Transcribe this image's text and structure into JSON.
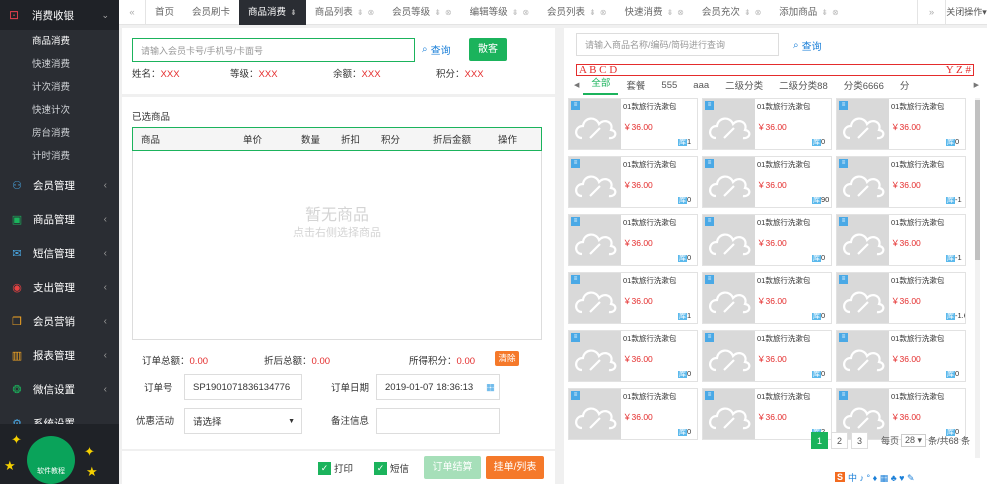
{
  "sidebar": {
    "section_title": "消费收银",
    "sub_items": [
      "商品消费",
      "快速消费",
      "计次消费",
      "快速计次",
      "房台消费",
      "计时消费"
    ],
    "items": [
      {
        "label": "会员管理",
        "icon": "users-icon"
      },
      {
        "label": "商品管理",
        "icon": "box-icon"
      },
      {
        "label": "短信管理",
        "icon": "sms-icon"
      },
      {
        "label": "支出管理",
        "icon": "money-icon"
      },
      {
        "label": "会员营销",
        "icon": "gift-icon"
      },
      {
        "label": "报表管理",
        "icon": "chart-icon"
      },
      {
        "label": "微信设置",
        "icon": "wechat-icon"
      },
      {
        "label": "系统设置",
        "icon": "gear-icon"
      }
    ],
    "brand_label": "软件教程"
  },
  "tabs": [
    {
      "label": "首页",
      "closable": false
    },
    {
      "label": "会员刷卡",
      "closable": false
    },
    {
      "label": "商品消费",
      "closable": false,
      "active": true,
      "mark": "⇟"
    },
    {
      "label": "商品列表",
      "closable": true
    },
    {
      "label": "会员等级",
      "closable": true
    },
    {
      "label": "编辑等级",
      "closable": true
    },
    {
      "label": "会员列表",
      "closable": true
    },
    {
      "label": "快速消费",
      "closable": true
    },
    {
      "label": "会员充次",
      "closable": true
    },
    {
      "label": "添加商品",
      "closable": true
    }
  ],
  "close_ops": "关闭操作",
  "member": {
    "search_placeholder": "请输入会员卡号/手机号/卡面号",
    "query_label": "查询",
    "walkin_label": "散客",
    "name_label": "姓名：",
    "name_value": "XXX",
    "level_label": "等级：",
    "level_value": "XXX",
    "balance_label": "余额：",
    "balance_value": "XXX",
    "points_label": "积分：",
    "points_value": "XXX"
  },
  "cart": {
    "title": "已选商品",
    "columns": [
      "商品",
      "单价",
      "数量",
      "折扣",
      "积分",
      "折后金额",
      "操作"
    ],
    "empty_title": "暂无商品",
    "empty_hint": "点击右侧选择商品"
  },
  "summary": {
    "total_label": "订单总额：",
    "total_value": "0.00",
    "discount_label": "折后总额：",
    "discount_value": "0.00",
    "points_label": "所得积分：",
    "points_value": "0.00",
    "clear_label": "清除"
  },
  "order": {
    "no_label": "订单号",
    "no_value": "SP1901071836134776",
    "date_label": "订单日期",
    "date_value": "2019-01-07 18:36:13",
    "promo_label": "优惠活动",
    "promo_value": "请选择",
    "remark_label": "备注信息",
    "remark_value": ""
  },
  "actions": {
    "print": "打印",
    "sms": "短信",
    "checkout": "订单结算",
    "hold": "挂单/列表"
  },
  "products": {
    "search_placeholder": "请输入商品名称/编码/简码进行查询",
    "query_label": "查询",
    "letters_left": "A B C D",
    "letters_right": "Y Z #",
    "categories": [
      "全部",
      "套餐",
      "555",
      "aaa",
      "二级分类",
      "二级分类88",
      "分类6666",
      "分"
    ],
    "items": [
      {
        "name": "01款旅行洗漱包",
        "price": "36.00",
        "stock": "1"
      },
      {
        "name": "01款旅行洗漱包",
        "price": "36.00",
        "stock": "0"
      },
      {
        "name": "01款旅行洗漱包",
        "price": "36.00",
        "stock": "0"
      },
      {
        "name": "01款旅行洗漱包",
        "price": "36.00",
        "stock": "0"
      },
      {
        "name": "01款旅行洗漱包",
        "price": "36.00",
        "stock": "90"
      },
      {
        "name": "01款旅行洗漱包",
        "price": "36.00",
        "stock": "-1"
      },
      {
        "name": "01款旅行洗漱包",
        "price": "36.00",
        "stock": "0"
      },
      {
        "name": "01款旅行洗漱包",
        "price": "36.00",
        "stock": "0"
      },
      {
        "name": "01款旅行洗漱包",
        "price": "36.00",
        "stock": "-1"
      },
      {
        "name": "01款旅行洗漱包",
        "price": "36.00",
        "stock": "1"
      },
      {
        "name": "01款旅行洗漱包",
        "price": "36.00",
        "stock": "0"
      },
      {
        "name": "01款旅行洗漱包",
        "price": "36.00",
        "stock": "-1.6"
      },
      {
        "name": "01款旅行洗漱包",
        "price": "36.00",
        "stock": "0"
      },
      {
        "name": "01款旅行洗漱包",
        "price": "36.00",
        "stock": "0"
      },
      {
        "name": "01款旅行洗漱包",
        "price": "36.00",
        "stock": "0"
      },
      {
        "name": "01款旅行洗漱包",
        "price": "36.00",
        "stock": "0"
      },
      {
        "name": "01款旅行洗漱包",
        "price": "36.00",
        "stock": "2"
      },
      {
        "name": "01款旅行洗漱包",
        "price": "36.00",
        "stock": "0"
      }
    ],
    "stock_prefix": "库",
    "currency": "￥"
  },
  "pager": {
    "pages": [
      "1",
      "2",
      "3"
    ],
    "per_page_label": "每页",
    "per_page_value": "28",
    "total_label": "条/共68 条"
  },
  "ime": "中 ♪ ° ♦ ▦ ♣ ♥ ✎"
}
